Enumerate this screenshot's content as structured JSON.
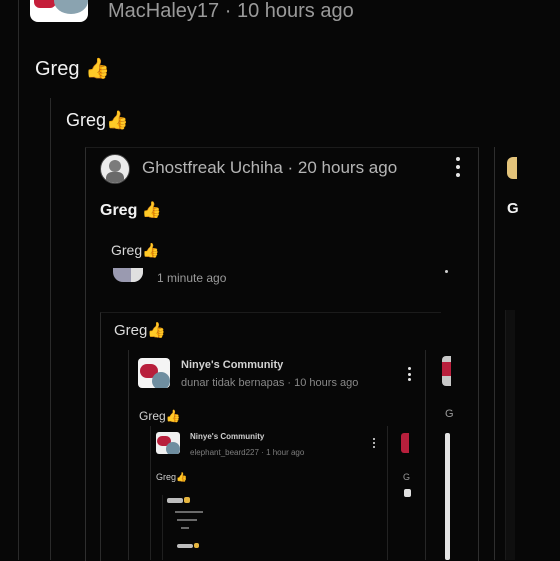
{
  "top_comment": {
    "username": "MacHaley17",
    "separator": " · ",
    "time": "10 hours ago",
    "text": "Greg",
    "emoji": "👍"
  },
  "level1": {
    "text": "Greg",
    "emoji": "👍"
  },
  "ghost_comment": {
    "username": "Ghostfreak Uchiha",
    "separator": " · ",
    "time": "20 hours ago",
    "text": "Greg",
    "emoji": "👍"
  },
  "reply_greg": {
    "text": "Greg",
    "emoji": "👍",
    "time": "1 minute ago"
  },
  "embedded_greg": {
    "text": "Greg",
    "emoji": "👍"
  },
  "ninye_card": {
    "community": "Ninye's Community",
    "author": "dunar tidak bernapas",
    "separator": " · ",
    "time": "10 hours ago",
    "text": "Greg",
    "emoji": "👍"
  },
  "ninye_card_small": {
    "community": "Ninye's Community",
    "author": "elephant_beard227",
    "separator": " · ",
    "time": "1 hour ago",
    "text": "Greg",
    "emoji": "👍"
  },
  "right_strip": {
    "initial_top": "G",
    "initial_mid": "G",
    "initial_low": "G"
  }
}
